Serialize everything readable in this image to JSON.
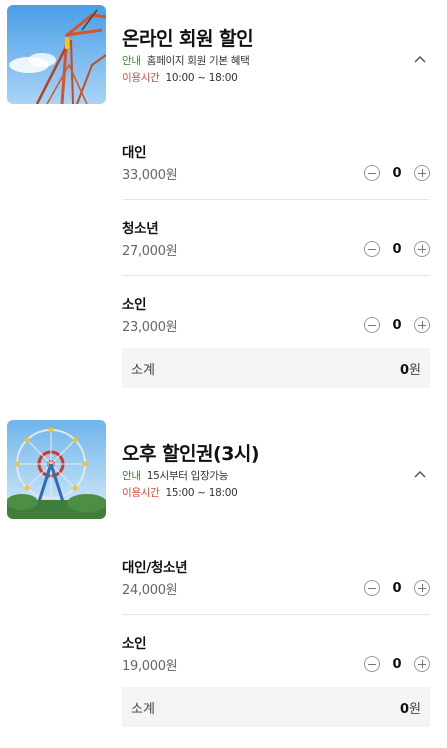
{
  "products": [
    {
      "title": "온라인 회원 할인",
      "info_tag": "안내",
      "info_text": "홈페이지 회원 기본 혜택",
      "hours_tag": "이용시간",
      "hours_text": "10:00 ~ 18:00",
      "image_icon": "roller-coaster-image",
      "rows": [
        {
          "name": "대인",
          "price": "33,000원",
          "qty": "0"
        },
        {
          "name": "청소년",
          "price": "27,000원",
          "qty": "0"
        },
        {
          "name": "소인",
          "price": "23,000원",
          "qty": "0"
        }
      ],
      "subtotal_label": "소계",
      "subtotal_value": "0",
      "subtotal_unit": "원"
    },
    {
      "title": "오후 할인권(3시)",
      "info_tag": "안내",
      "info_text": "15시부터 입장가능",
      "hours_tag": "이용시간",
      "hours_text": "15:00 ~ 18:00",
      "image_icon": "ferris-wheel-image",
      "rows": [
        {
          "name": "대인/청소년",
          "price": "24,000원",
          "qty": "0"
        },
        {
          "name": "소인",
          "price": "19,000원",
          "qty": "0"
        }
      ],
      "subtotal_label": "소계",
      "subtotal_value": "0",
      "subtotal_unit": "원"
    }
  ],
  "colors": {
    "info_tag": "#2e8b2e",
    "hours_tag": "#e0473c",
    "subtotal_bg": "#f4f4f4",
    "divider": "#e6e6e6"
  }
}
